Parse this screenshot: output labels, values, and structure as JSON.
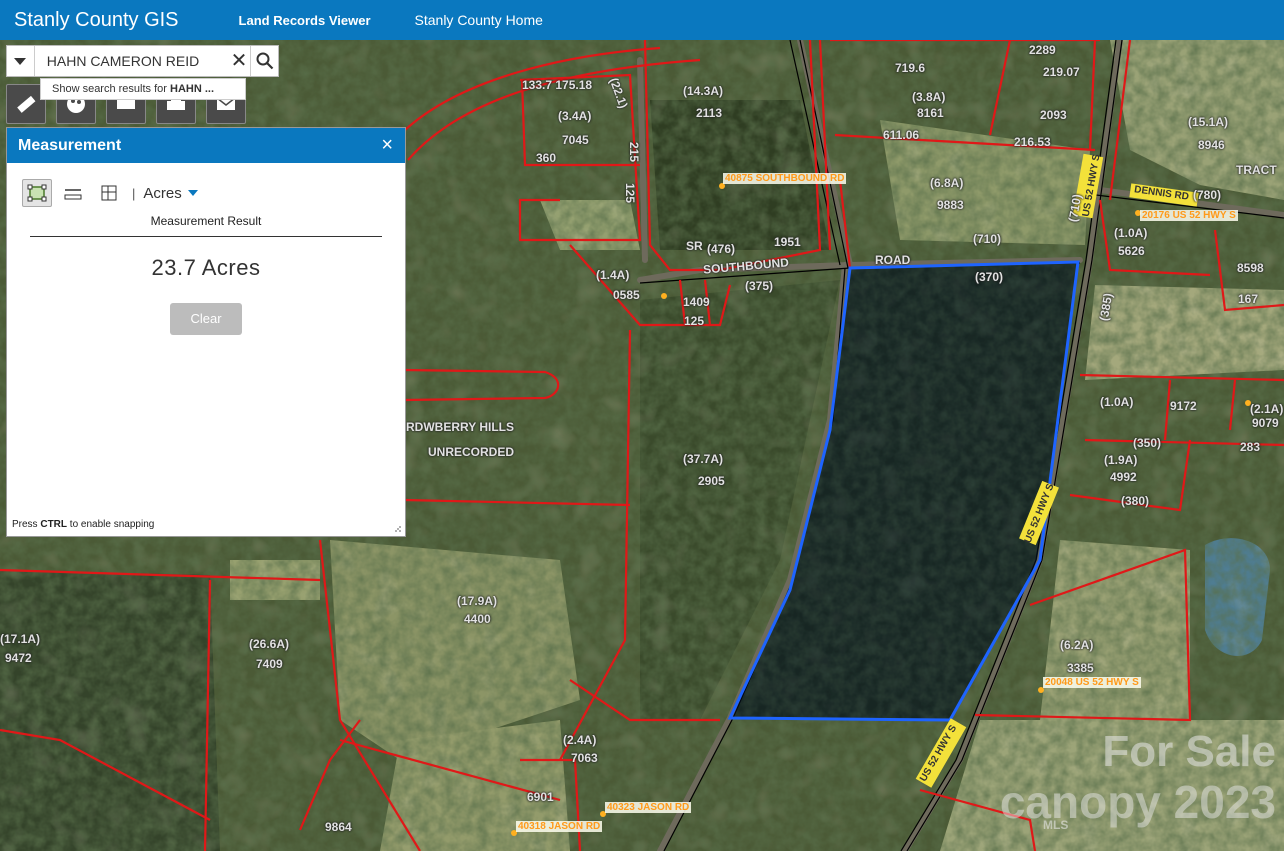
{
  "header": {
    "app_title": "Stanly County GIS",
    "nav": [
      "Land Records Viewer",
      "Stanly County Home"
    ],
    "bg_color": "#0a78bf"
  },
  "search": {
    "value": "HAHN CAMERON REID",
    "suggestion_prefix": "Show search results for ",
    "suggestion_term": "HAHN ..."
  },
  "toolbar": {
    "tools": [
      "ruler-icon",
      "palette-icon",
      "layers-icon",
      "print-icon",
      "mail-icon"
    ]
  },
  "measurement": {
    "title": "Measurement",
    "close": "×",
    "unit": "Acres",
    "separator": "|",
    "result_label": "Measurement Result",
    "result_value": "23.7 Acres",
    "clear_label": "Clear",
    "snap_prefix": "Press ",
    "snap_key": "CTRL",
    "snap_suffix": " to enable snapping"
  },
  "map": {
    "parcel_labels": [
      "2289",
      "719.6",
      "219.07",
      "133.7 175.18",
      "(3.4A)",
      "7045",
      "(22.1)",
      "(14.3A)",
      "2113",
      "(3.8A)",
      "8161",
      "611.06",
      "(15.1A)",
      "8946",
      "TRACT",
      "216.53",
      "2093",
      "360",
      "215",
      "125",
      "(6.8A)",
      "9883",
      "(1.0A)",
      "5626",
      "8598",
      "167",
      "(1.4A)",
      "0585",
      "1409",
      "125",
      "(37.7A)",
      "2905",
      "(1.0A)",
      "9172",
      "(2.1A)",
      "9079",
      "(1.9A)",
      "4992",
      "(380)",
      "283",
      "(17.9A)",
      "4400",
      "(26.6A)",
      "7409",
      "(17.1A)",
      "9472",
      "(6.2A)",
      "3385",
      "(2.4A)",
      "7063",
      "6901",
      "9864",
      "RDWBERRY HILLS",
      "UNRECORDED",
      "(710)",
      "(370)",
      "(375)",
      "(476)",
      "1951",
      "(710)",
      "(780)",
      "(350)",
      "(385)"
    ],
    "road_labels": [
      "SOUTHBOUND",
      "ROAD",
      "SR",
      "DENNIS RD",
      "US 52 HWY S",
      "US 52 HWY S",
      "US 52 HWY S"
    ],
    "address_labels": [
      "40875 SOUTHBOUND RD",
      "20176 US 52 HWY S",
      "20048 US 52 HWY S",
      "40323 JASON RD",
      "40318 JASON RD"
    ],
    "measured_polygon_color": "#1e64ff",
    "parcel_line_color": "#e01818"
  },
  "watermark": {
    "line1": "For Sale",
    "line2": "canopy 2023",
    "line3": "MLS"
  }
}
